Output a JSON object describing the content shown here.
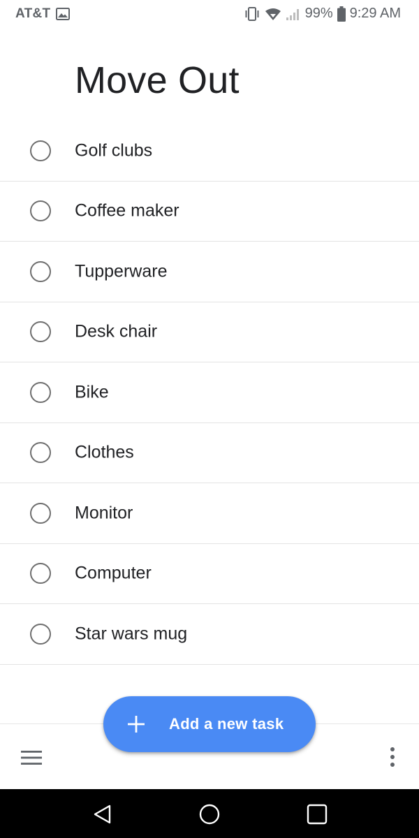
{
  "status_bar": {
    "carrier": "AT&T",
    "battery": "99%",
    "time": "9:29 AM"
  },
  "list": {
    "title": "Move Out",
    "tasks": [
      {
        "label": "Golf clubs",
        "completed": false
      },
      {
        "label": "Coffee maker",
        "completed": false
      },
      {
        "label": "Tupperware",
        "completed": false
      },
      {
        "label": "Desk chair",
        "completed": false
      },
      {
        "label": "Bike",
        "completed": false
      },
      {
        "label": "Clothes",
        "completed": false
      },
      {
        "label": "Monitor",
        "completed": false
      },
      {
        "label": "Computer",
        "completed": false
      },
      {
        "label": "Star wars mug",
        "completed": false
      }
    ]
  },
  "fab": {
    "label": "Add a new task",
    "icon": "plus-icon",
    "color": "#4a8af4"
  },
  "bottom_bar": {
    "left_icon": "menu-icon",
    "right_icon": "more-vert-icon"
  },
  "nav_bar": {
    "icons": [
      "back-icon",
      "home-icon",
      "recents-icon"
    ]
  }
}
